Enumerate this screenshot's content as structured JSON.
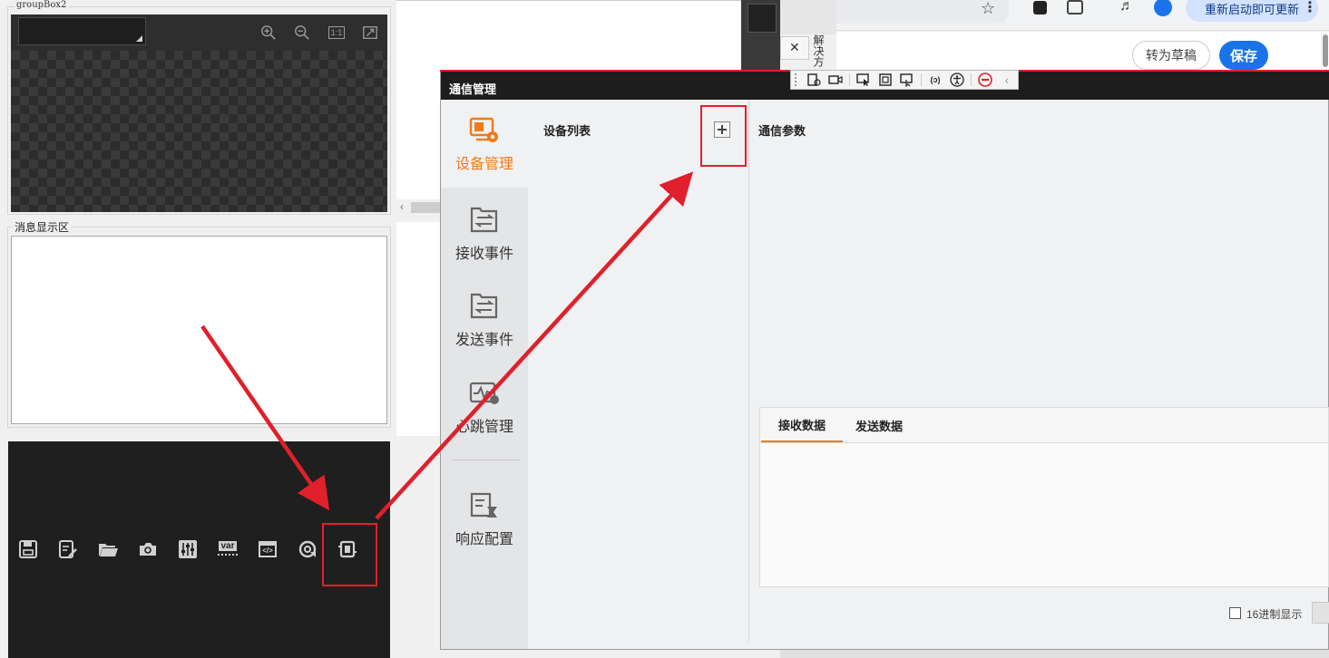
{
  "left_panel": {
    "groupbox_title": "groupBox2",
    "message_area_title": "消息显示区",
    "image_toolbar": [
      {
        "name": "zoom-in-icon"
      },
      {
        "name": "zoom-out-icon"
      },
      {
        "name": "actual-size-icon",
        "label": "1:1"
      },
      {
        "name": "fit-window-icon"
      }
    ],
    "bottom_toolbar": [
      {
        "name": "save-icon"
      },
      {
        "name": "save-as-icon"
      },
      {
        "name": "open-folder-icon"
      },
      {
        "name": "camera-icon"
      },
      {
        "name": "sliders-icon"
      },
      {
        "name": "variable-icon",
        "label": "var"
      },
      {
        "name": "script-icon",
        "label": "</>"
      },
      {
        "name": "loop-icon"
      },
      {
        "name": "communication-device-icon"
      }
    ]
  },
  "browser": {
    "update_button": "重新启动即可更新",
    "draft_button": "转为草稿",
    "save_button": "保存",
    "side_text": "解决方"
  },
  "dialog": {
    "title": "通信管理",
    "nav": [
      {
        "label": "设备管理",
        "active": true
      },
      {
        "label": "接收事件",
        "active": false
      },
      {
        "label": "发送事件",
        "active": false
      },
      {
        "label": "心跳管理",
        "active": false
      },
      {
        "label": "响应配置",
        "active": false
      }
    ],
    "device_list_title": "设备列表",
    "comm_params_title": "通信参数",
    "tabs": [
      {
        "label": "接收数据",
        "active": true
      },
      {
        "label": "发送数据",
        "active": false
      }
    ],
    "hex_display_label": "16进制显示",
    "accent_color": "#ef7a1a"
  },
  "annotation_color": "#e0202a"
}
